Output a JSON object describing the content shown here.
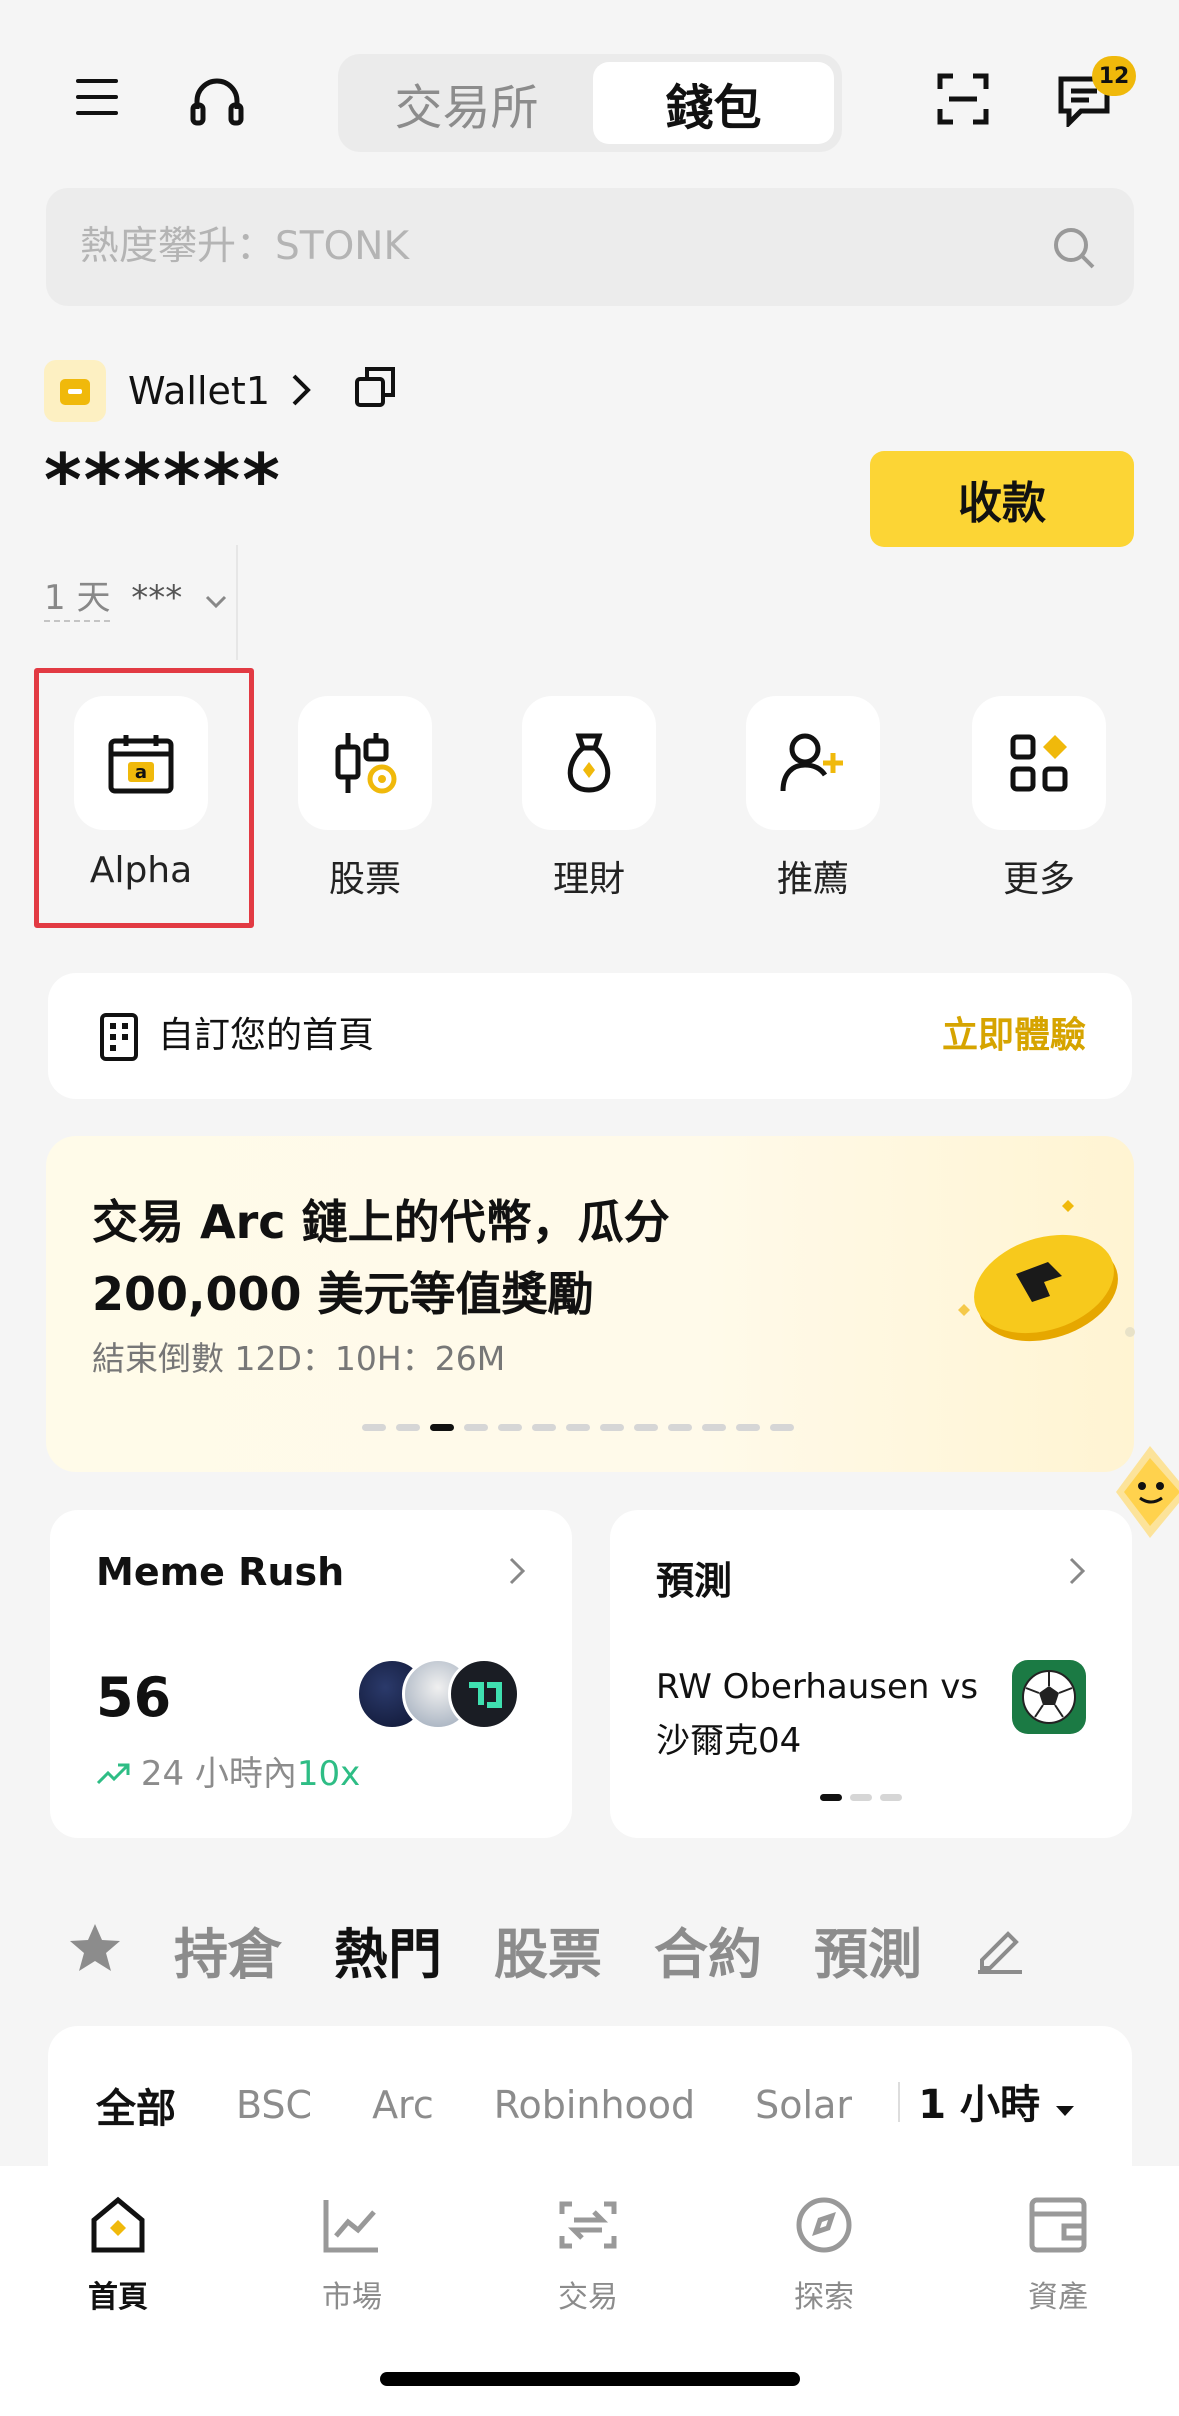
{
  "header": {
    "segments": [
      "交易所",
      "錢包"
    ],
    "active_segment": 1,
    "notifications_count": "12"
  },
  "search": {
    "placeholder": "熱度攀升：STONK"
  },
  "wallet": {
    "name": "Wallet1",
    "balance_masked": "******",
    "receive_label": "收款",
    "period_label": "1 天",
    "period_value": "***"
  },
  "shortcuts": [
    {
      "label": "Alpha",
      "icon": "alpha-calendar-icon"
    },
    {
      "label": "股票",
      "icon": "candlestick-icon"
    },
    {
      "label": "理財",
      "icon": "money-bag-icon"
    },
    {
      "label": "推薦",
      "icon": "add-user-icon"
    },
    {
      "label": "更多",
      "icon": "grid-more-icon"
    }
  ],
  "customize": {
    "text": "自訂您的首頁",
    "action": "立即體驗"
  },
  "banner": {
    "title": "交易 Arc 鏈上的代幣，瓜分 200,000 美元等值獎勵",
    "countdown": "結束倒數 12D：10H：26M",
    "dot_count": 13,
    "active_dot": 2
  },
  "meme_rush": {
    "title": "Meme Rush",
    "value": "56",
    "growth_prefix": "24 小時內",
    "growth_value": "10x"
  },
  "prediction": {
    "title": "預測",
    "match": "RW Oberhausen vs 沙爾克04"
  },
  "tabs": [
    "持倉",
    "熱門",
    "股票",
    "合約",
    "預測"
  ],
  "active_tab": 1,
  "filters": [
    "全部",
    "BSC",
    "Arc",
    "Robinhood",
    "Solar"
  ],
  "time_range": "1 小時",
  "bottom_nav": [
    {
      "label": "首頁",
      "icon": "home-icon"
    },
    {
      "label": "市場",
      "icon": "market-chart-icon"
    },
    {
      "label": "交易",
      "icon": "trade-swap-icon"
    },
    {
      "label": "探索",
      "icon": "discover-compass-icon"
    },
    {
      "label": "資產",
      "icon": "assets-wallet-icon"
    }
  ],
  "colors": {
    "accent": "#fcd535",
    "accent_text": "#d6a400",
    "highlight_box": "#e23a43",
    "positive": "#2ebd85"
  }
}
